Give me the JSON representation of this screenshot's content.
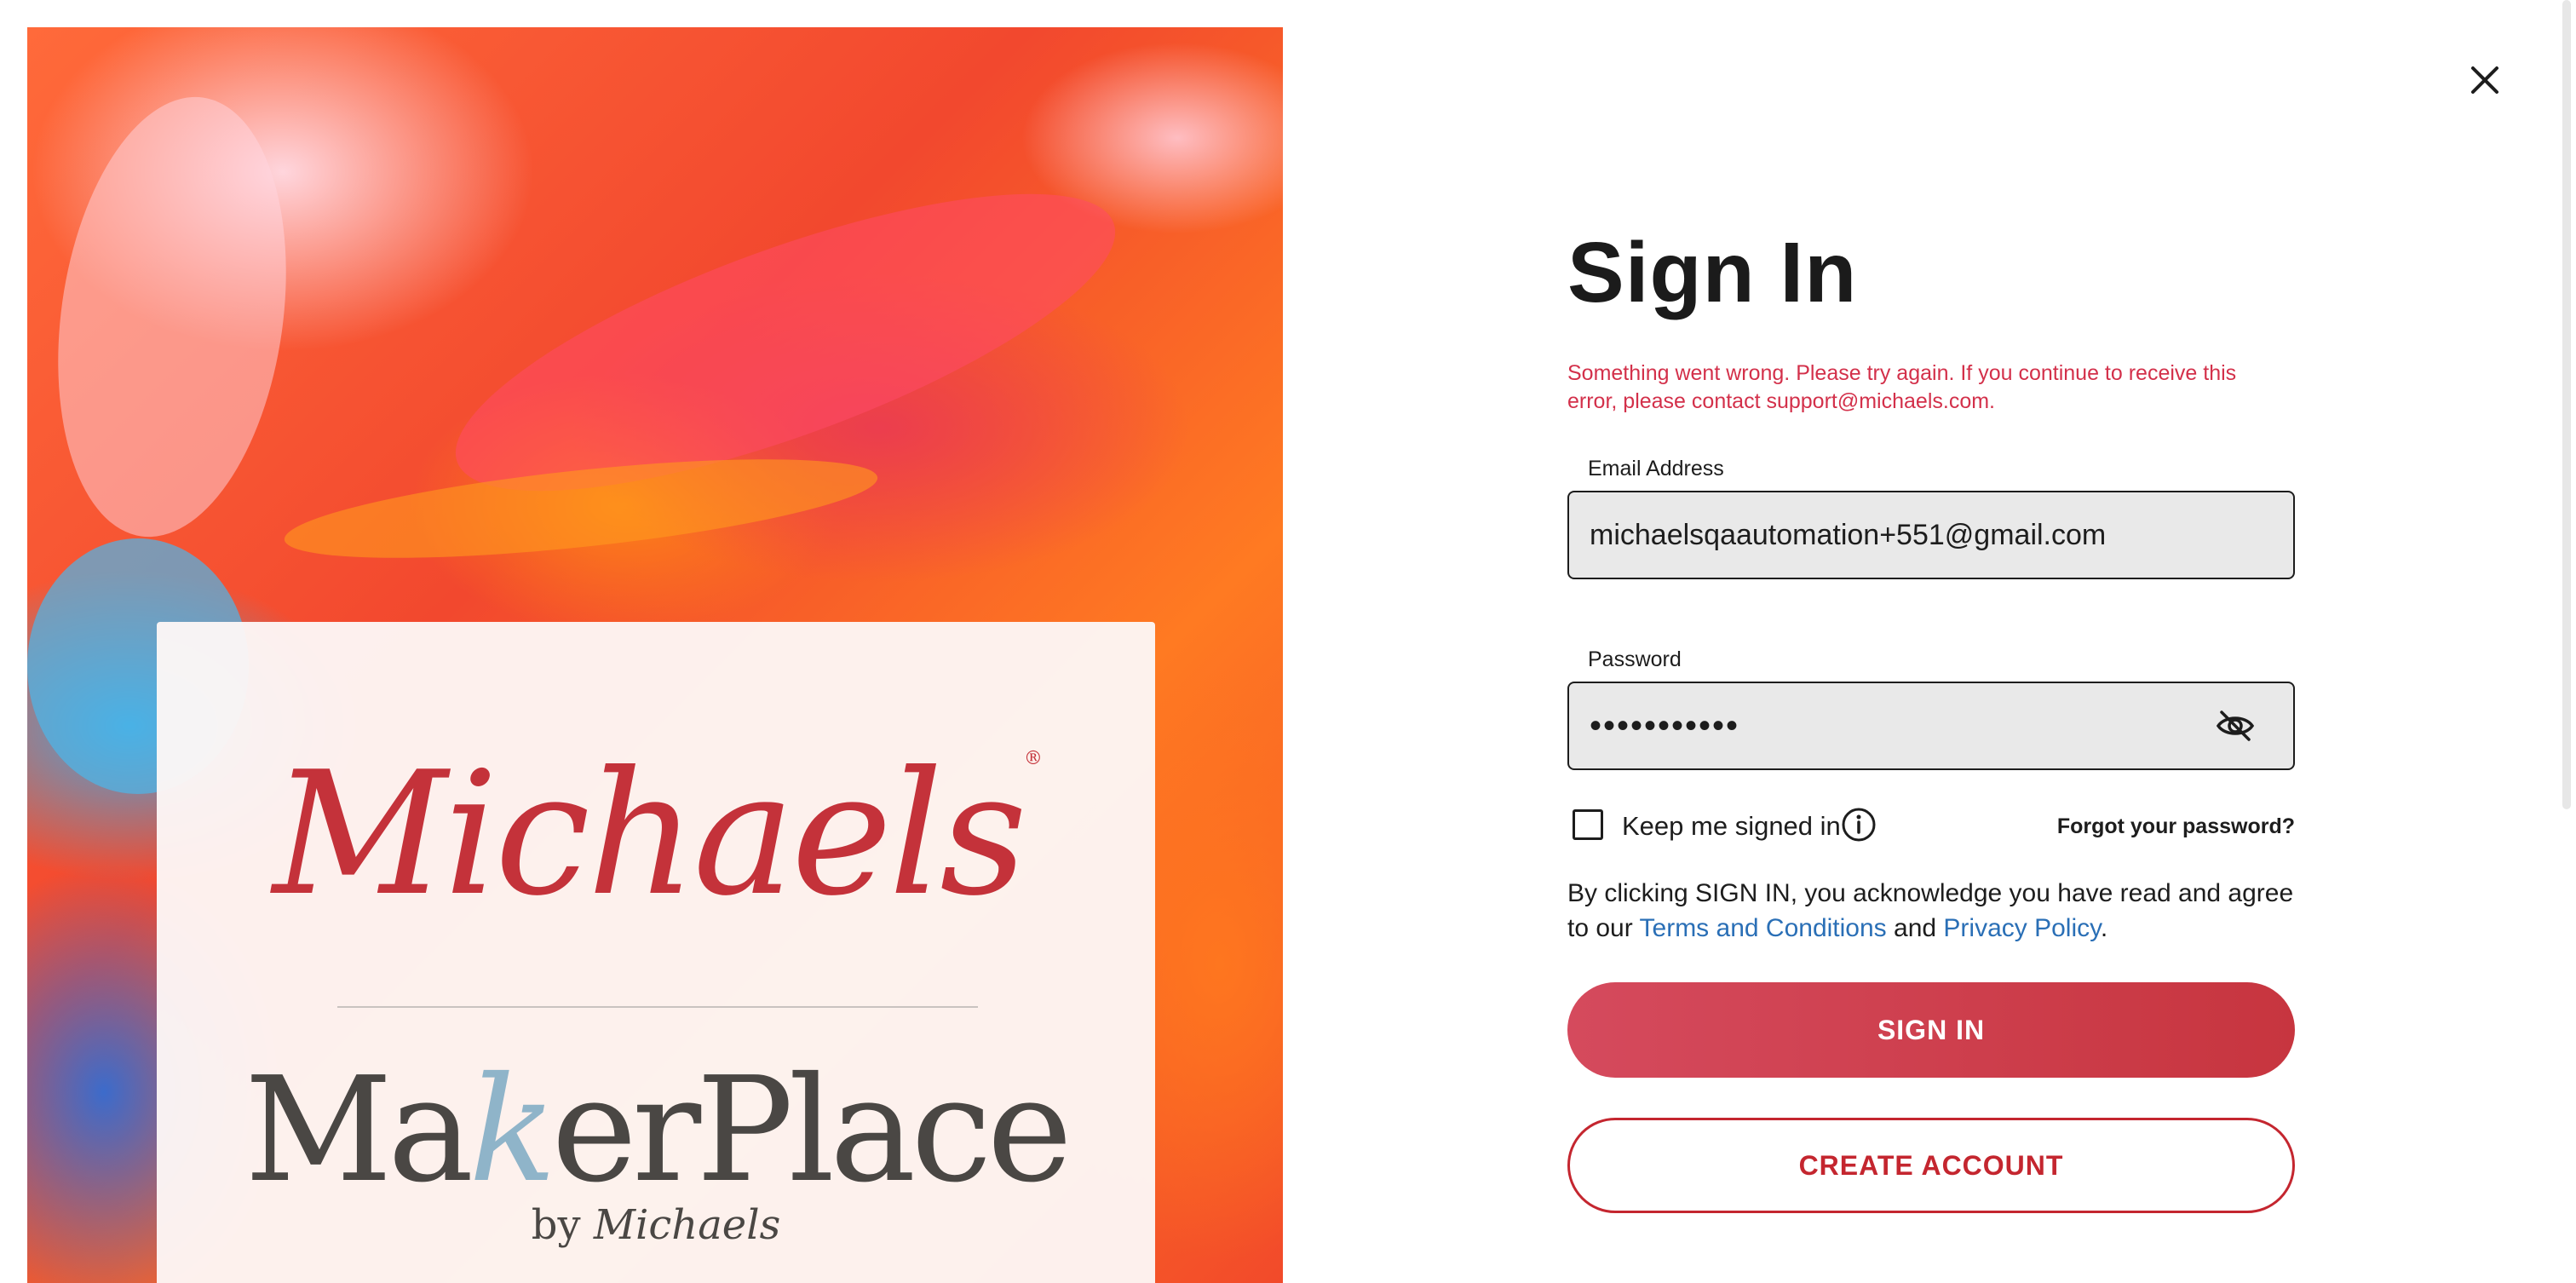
{
  "hero": {
    "michaels_logo_text": "Michaels",
    "michaels_logo_mark": "®",
    "makerplace_logo_pre": "Ma",
    "makerplace_logo_k": "k",
    "makerplace_logo_post": "erPlace",
    "makerplace_by": "by",
    "makerplace_by_brand": "Michaels"
  },
  "form": {
    "title": "Sign In",
    "error": "Something went wrong. Please try again. If you continue to receive this error, please contact support@michaels.com.",
    "email_label": "Email Address",
    "email_value": "michaelsqaautomation+551@gmail.com",
    "password_label": "Password",
    "password_value": "•••••••••••",
    "keep_signed_in": "Keep me signed in",
    "forgot_password": "Forgot your password?",
    "agree_prefix": "By clicking SIGN IN, you acknowledge you have read and agree to our ",
    "terms_link": "Terms and Conditions",
    "agree_and": " and ",
    "privacy_link": "Privacy Policy",
    "agree_suffix": ".",
    "sign_in_button": "SIGN IN",
    "create_account_button": "CREATE ACCOUNT"
  },
  "colors": {
    "brand_red": "#c4262f",
    "error_red": "#d3304a",
    "link_blue": "#2a6fb6"
  },
  "icons": {
    "close": "close-icon",
    "eye": "eye-slash-icon",
    "info": "info-icon"
  }
}
